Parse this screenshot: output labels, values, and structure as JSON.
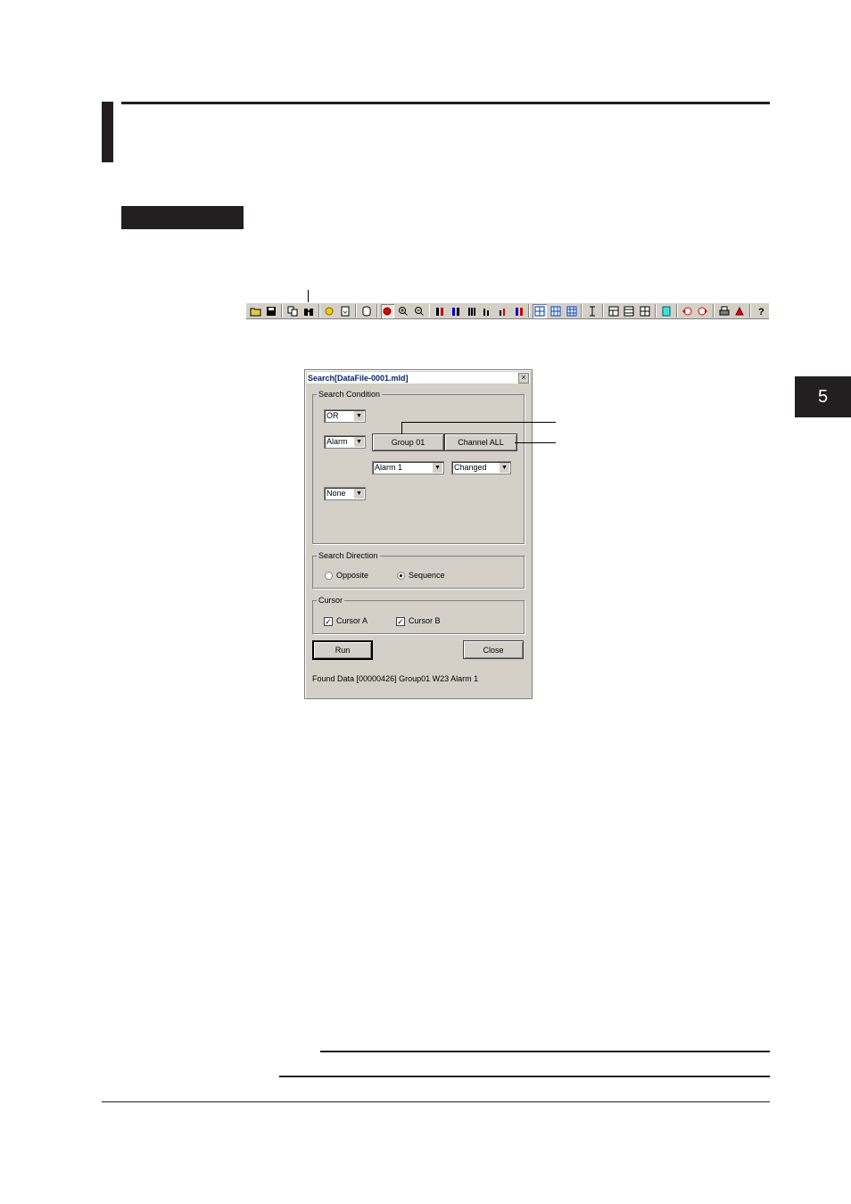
{
  "side_tab": {
    "number": "5"
  },
  "toolbar": {
    "icons": [
      "open-folder-icon",
      "save-icon",
      "copy-icon",
      "search-binoculars-icon",
      "settings-icon",
      "export-icon",
      "database-icon",
      "record-icon",
      "zoom-in-icon",
      "zoom-out-icon",
      "display-1-icon",
      "display-2-icon",
      "display-3-icon",
      "display-4-icon",
      "display-5-icon",
      "display-6-icon",
      "grid-1-icon",
      "grid-2-icon",
      "grid-3-icon",
      "cursor-icon",
      "layout-1-icon",
      "layout-2-icon",
      "layout-3-icon",
      "note-icon",
      "prev-icon",
      "next-icon",
      "print-icon",
      "alarm-icon",
      "help-icon"
    ]
  },
  "dialog": {
    "title": "Search[DataFile-0001.mld]",
    "close_glyph": "×",
    "search_condition": {
      "label": "Search Condition",
      "logic": "OR",
      "type": "Alarm",
      "group_button": "Group 01",
      "channel_button": "Channel ALL",
      "alarm_select": "Alarm 1",
      "state_select": "Changed",
      "second_type": "None"
    },
    "search_direction": {
      "label": "Search Direction",
      "opposite": "Opposite",
      "sequence": "Sequence",
      "selected": "Sequence"
    },
    "cursor": {
      "label": "Cursor",
      "cursor_a": "Cursor A",
      "cursor_b": "Cursor B",
      "cursor_a_checked": true,
      "cursor_b_checked": true
    },
    "run_button": "Run",
    "close_button": "Close",
    "status": "Found Data [00000426] Group01 W23 Alarm 1"
  }
}
